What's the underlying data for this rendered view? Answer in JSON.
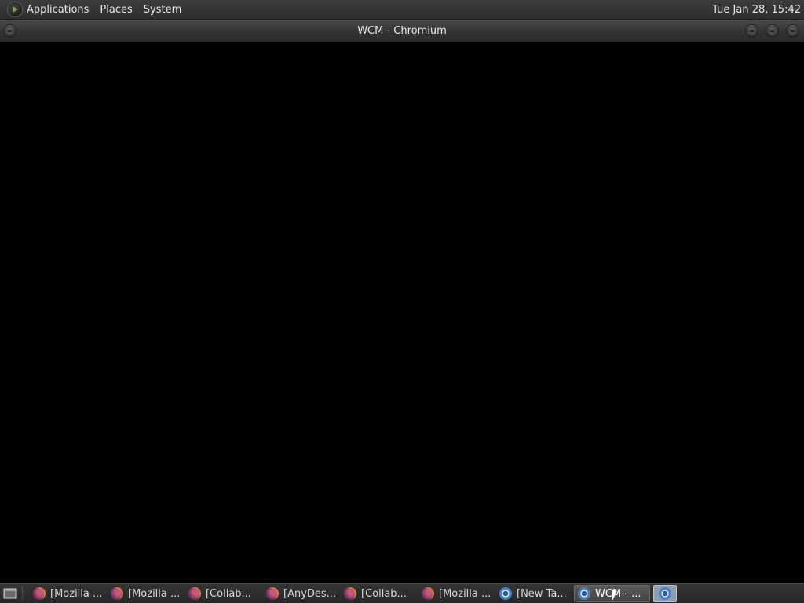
{
  "top_panel": {
    "menu_items": [
      "Applications",
      "Places",
      "System"
    ],
    "clock": "Tue Jan 28, 15:42"
  },
  "window": {
    "title": "WCM - Chromium"
  },
  "taskbar": {
    "tasks": [
      {
        "label": "[Mozilla ...",
        "icon": "firefox-icon"
      },
      {
        "label": "[Mozilla ...",
        "icon": "firefox-icon"
      },
      {
        "label": "[Collab...",
        "icon": "firefox-icon"
      },
      {
        "label": "[AnyDes...",
        "icon": "firefox-icon"
      },
      {
        "label": "[Collab...",
        "icon": "firefox-icon"
      },
      {
        "label": "[Mozilla ...",
        "icon": "firefox-icon"
      },
      {
        "label": "[New Ta...",
        "icon": "chromium-icon"
      },
      {
        "label": "WCM - ...",
        "icon": "chromium-icon",
        "active": true
      }
    ]
  },
  "colors": {
    "panel_bg": "#2e2e2e",
    "content_bg": "#000000",
    "text": "#e6e6e6"
  }
}
